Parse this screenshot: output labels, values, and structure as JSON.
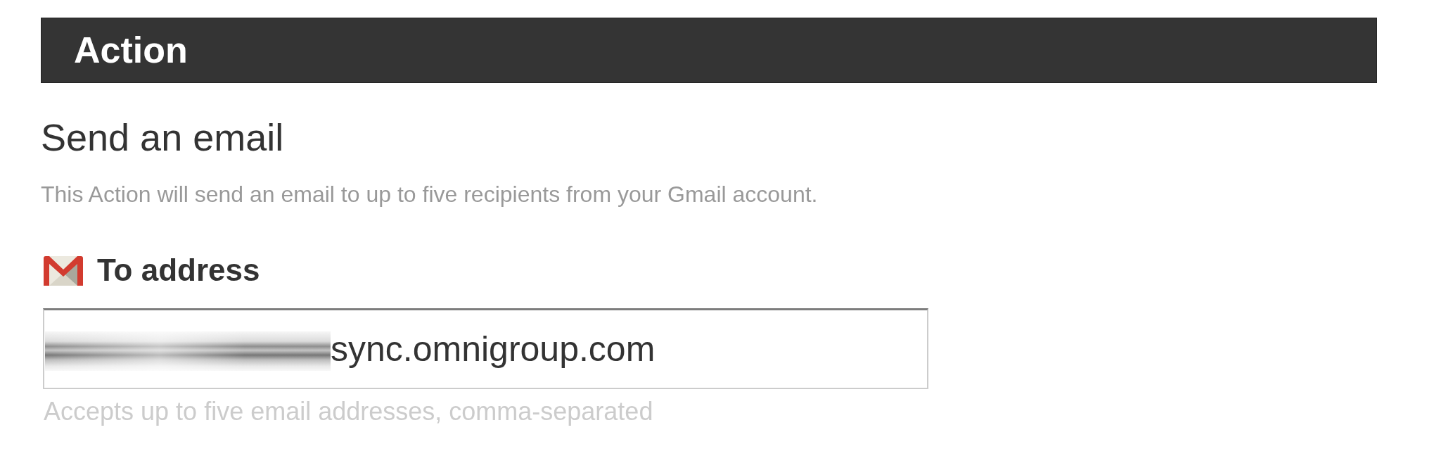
{
  "header": {
    "title": "Action"
  },
  "action": {
    "title": "Send an email",
    "description": "This Action will send an email to up to five recipients from your Gmail account."
  },
  "fields": [
    {
      "label": "To address",
      "value": "sync.omnigroup.com",
      "redacted_prefix": true,
      "help": "Accepts up to five email addresses, comma-separated"
    }
  ]
}
